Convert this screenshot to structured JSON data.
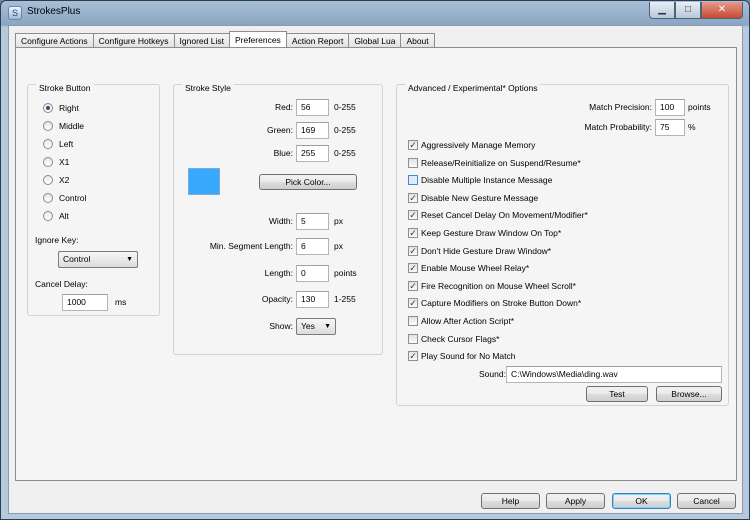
{
  "window": {
    "title": "StrokesPlus",
    "icon_name": "strokesplus-app-icon"
  },
  "caption_buttons": {
    "minimize": "▁",
    "maximize": "□",
    "close": "✕"
  },
  "tabs": [
    "Configure Actions",
    "Configure Hotkeys",
    "Ignored List",
    "Preferences",
    "Action Report",
    "Global Lua",
    "About"
  ],
  "active_tab": "Preferences",
  "stroke_button": {
    "title": "Stroke Button",
    "options": [
      "Right",
      "Middle",
      "Left",
      "X1",
      "X2",
      "Control",
      "Alt"
    ],
    "selected": "Right",
    "ignore_key_label": "Ignore Key:",
    "ignore_key_value": "Control",
    "cancel_delay_label": "Cancel Delay:",
    "cancel_delay_value": "1000",
    "cancel_delay_unit": "ms"
  },
  "stroke_style": {
    "title": "Stroke Style",
    "red_label": "Red:",
    "red_value": "56",
    "red_range": "0-255",
    "green_label": "Green:",
    "green_value": "169",
    "green_range": "0-255",
    "blue_label": "Blue:",
    "blue_value": "255",
    "blue_range": "0-255",
    "swatch_color": "#38a9ff",
    "pick_color_label": "Pick Color...",
    "width_label": "Width:",
    "width_value": "5",
    "width_unit": "px",
    "min_segment_label": "Min. Segment Length:",
    "min_segment_value": "6",
    "min_segment_unit": "px",
    "length_label": "Length:",
    "length_value": "0",
    "length_unit": "points",
    "opacity_label": "Opacity:",
    "opacity_value": "130",
    "opacity_range": "1-255",
    "show_label": "Show:",
    "show_value": "Yes"
  },
  "advanced": {
    "title": "Advanced / Experimental* Options",
    "match_precision_label": "Match Precision:",
    "match_precision_value": "100",
    "match_precision_unit": "points",
    "match_probability_label": "Match Probability:",
    "match_probability_value": "75",
    "match_probability_unit": "%",
    "options": [
      {
        "label": "Aggressively Manage Memory",
        "checked": true
      },
      {
        "label": "Release/Reinitialize on Suspend/Resume*",
        "checked": false
      },
      {
        "label": "Disable Multiple Instance Message",
        "checked": false
      },
      {
        "label": "Disable New Gesture Message",
        "checked": true
      },
      {
        "label": "Reset Cancel Delay On Movement/Modifier*",
        "checked": true
      },
      {
        "label": "Keep Gesture Draw Window On Top*",
        "checked": true
      },
      {
        "label": "Don't Hide Gesture Draw Window*",
        "checked": true
      },
      {
        "label": "Enable Mouse Wheel Relay*",
        "checked": true
      },
      {
        "label": "Fire Recognition on Mouse Wheel Scroll*",
        "checked": true
      },
      {
        "label": "Capture Modifiers on Stroke Button Down*",
        "checked": true
      },
      {
        "label": "Allow After Action Script*",
        "checked": false
      },
      {
        "label": "Check Cursor Flags*",
        "checked": false
      },
      {
        "label": "Play Sound for No Match",
        "checked": true
      }
    ],
    "sound_label": "Sound:",
    "sound_value": "C:\\Windows\\Media\\ding.wav",
    "test_label": "Test",
    "browse_label": "Browse..."
  },
  "footer": {
    "help": "Help",
    "apply": "Apply",
    "ok": "OK",
    "cancel": "Cancel"
  },
  "check_glyph": "✓"
}
